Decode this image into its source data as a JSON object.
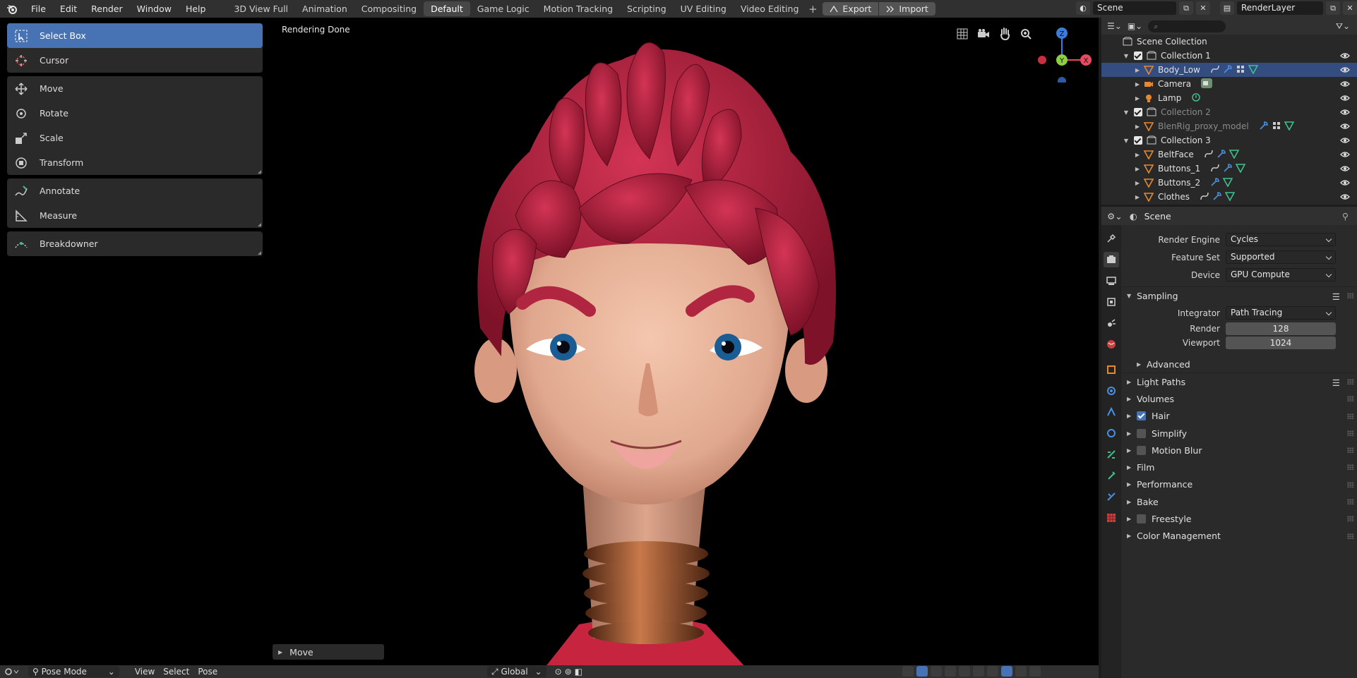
{
  "menu": [
    "File",
    "Edit",
    "Render",
    "Window",
    "Help"
  ],
  "workspaces": [
    {
      "label": "3D View Full",
      "active": false
    },
    {
      "label": "Animation",
      "active": false
    },
    {
      "label": "Compositing",
      "active": false
    },
    {
      "label": "Default",
      "active": true
    },
    {
      "label": "Game Logic",
      "active": false
    },
    {
      "label": "Motion Tracking",
      "active": false
    },
    {
      "label": "Scripting",
      "active": false
    },
    {
      "label": "UV Editing",
      "active": false
    },
    {
      "label": "Video Editing",
      "active": false
    }
  ],
  "add_workspace": "+",
  "export_label": "Export",
  "import_label": "Import",
  "scene_name": "Scene",
  "view_layer": "RenderLayer",
  "viewport": {
    "status": "Rendering Done",
    "tools": [
      [
        {
          "label": "Select Box",
          "icon": "select-box-icon",
          "active": true
        },
        {
          "label": "Cursor",
          "icon": "cursor-icon"
        }
      ],
      [
        {
          "label": "Move",
          "icon": "move-icon"
        },
        {
          "label": "Rotate",
          "icon": "rotate-icon"
        },
        {
          "label": "Scale",
          "icon": "scale-icon"
        },
        {
          "label": "Transform",
          "icon": "transform-icon"
        }
      ],
      [
        {
          "label": "Annotate",
          "icon": "annotate-icon"
        },
        {
          "label": "Measure",
          "icon": "measure-icon"
        }
      ],
      [
        {
          "label": "Breakdowner",
          "icon": "breakdowner-icon"
        }
      ]
    ],
    "last_operator": "Move",
    "gizmo_axes": {
      "z": "Z",
      "y": "Y",
      "x": "X"
    }
  },
  "bottom_header": {
    "mode": "Pose Mode",
    "menus": [
      "View",
      "Select",
      "Pose"
    ],
    "orientation": "Global"
  },
  "outliner": {
    "root": "Scene Collection",
    "rows": [
      {
        "label": "Collection 1",
        "type": "collection",
        "indent": 0,
        "expanded": true
      },
      {
        "label": "Body_Low",
        "type": "mesh",
        "indent": 1,
        "selected": true,
        "mods": [
          "armature",
          "wrench",
          "particles",
          "mesh"
        ]
      },
      {
        "label": "Camera",
        "type": "camera",
        "indent": 1,
        "mods": [
          "camera-data"
        ]
      },
      {
        "label": "Lamp",
        "type": "light",
        "indent": 1,
        "mods": [
          "light-data"
        ]
      },
      {
        "label": "Collection 2",
        "type": "collection",
        "indent": 0,
        "expanded": true,
        "dim": true
      },
      {
        "label": "BlenRig_proxy_model",
        "type": "mesh",
        "indent": 1,
        "dim": true,
        "mods": [
          "wrench",
          "particles",
          "mesh"
        ]
      },
      {
        "label": "Collection 3",
        "type": "collection",
        "indent": 0,
        "expanded": true
      },
      {
        "label": "BeltFace",
        "type": "mesh",
        "indent": 1,
        "mods": [
          "armature",
          "wrench",
          "mesh"
        ]
      },
      {
        "label": "Buttons_1",
        "type": "mesh",
        "indent": 1,
        "mods": [
          "armature",
          "wrench",
          "mesh"
        ]
      },
      {
        "label": "Buttons_2",
        "type": "mesh",
        "indent": 1,
        "mods": [
          "wrench",
          "mesh"
        ]
      },
      {
        "label": "Clothes",
        "type": "mesh",
        "indent": 1,
        "mods": [
          "armature",
          "wrench",
          "mesh"
        ]
      }
    ]
  },
  "properties": {
    "context": "Scene",
    "render_engine": {
      "label": "Render Engine",
      "value": "Cycles"
    },
    "feature_set": {
      "label": "Feature Set",
      "value": "Supported"
    },
    "device": {
      "label": "Device",
      "value": "GPU Compute"
    },
    "sampling": {
      "title": "Sampling",
      "integrator": {
        "label": "Integrator",
        "value": "Path Tracing"
      },
      "render": {
        "label": "Render",
        "value": "128"
      },
      "viewport": {
        "label": "Viewport",
        "value": "1024"
      },
      "advanced": "Advanced"
    },
    "panels": [
      {
        "label": "Light Paths",
        "list": true
      },
      {
        "label": "Volumes"
      },
      {
        "label": "Hair",
        "checkbox": true,
        "checked": true
      },
      {
        "label": "Simplify",
        "checkbox": true,
        "checked": false
      },
      {
        "label": "Motion Blur",
        "checkbox": true,
        "checked": false
      },
      {
        "label": "Film"
      },
      {
        "label": "Performance"
      },
      {
        "label": "Bake"
      },
      {
        "label": "Freestyle",
        "checkbox": true,
        "checked": false
      },
      {
        "label": "Color Management"
      }
    ]
  },
  "colors": {
    "accent": "#4772b3",
    "selection": "#334d80",
    "hair": "#b51f3c",
    "skin": "#e8b39a"
  }
}
